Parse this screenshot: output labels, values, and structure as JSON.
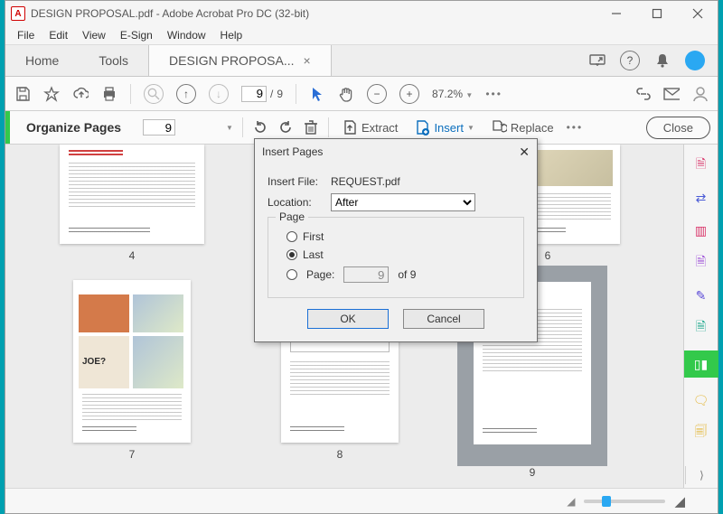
{
  "window": {
    "title": "DESIGN PROPOSAL.pdf - Adobe Acrobat Pro DC (32-bit)",
    "app_badge": "A"
  },
  "menu": {
    "file": "File",
    "edit": "Edit",
    "view": "View",
    "esign": "E-Sign",
    "window": "Window",
    "help": "Help"
  },
  "tabs": {
    "home": "Home",
    "tools": "Tools",
    "doc": "DESIGN PROPOSA..."
  },
  "toolbar": {
    "page_current": "9",
    "page_sep": "/",
    "page_total": "9",
    "zoom": "87.2%"
  },
  "orgbar": {
    "title": "Organize Pages",
    "page_box": "9",
    "extract": "Extract",
    "insert": "Insert",
    "replace": "Replace",
    "close": "Close"
  },
  "thumbs": {
    "p4": "4",
    "p6": "6",
    "p7": "7",
    "p8": "8",
    "p9": "9"
  },
  "dialog": {
    "title": "Insert Pages",
    "file_label": "Insert File:",
    "file_value": "REQUEST.pdf",
    "loc_label": "Location:",
    "loc_value": "After",
    "page_legend": "Page",
    "first": "First",
    "last": "Last",
    "page_radio": "Page:",
    "page_value": "9",
    "page_of": "of 9",
    "ok": "OK",
    "cancel": "Cancel"
  }
}
